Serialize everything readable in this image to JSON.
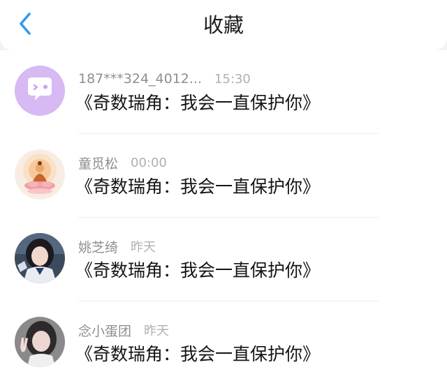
{
  "header": {
    "back_icon": "chevron-left-icon",
    "title": "收藏",
    "accent_color": "#2f9bf0"
  },
  "favorites": [
    {
      "name": "187***324_4012...",
      "time": "15:30",
      "message": "《奇数瑞角：我会一直保护你》",
      "avatar": "chat-bubble-wink-icon"
    },
    {
      "name": "童觅松",
      "time": "00:00",
      "message": "《奇数瑞角：我会一直保护你》",
      "avatar": "buddha-avatar"
    },
    {
      "name": "姚芝绮",
      "time": "昨天",
      "message": "《奇数瑞角：我会一直保护你》",
      "avatar": "girl-photo-avatar"
    },
    {
      "name": "念小蛋团",
      "time": "昨天",
      "message": "《奇数瑞角：我会一直保护你》",
      "avatar": "girl-peace-sign-avatar"
    }
  ]
}
